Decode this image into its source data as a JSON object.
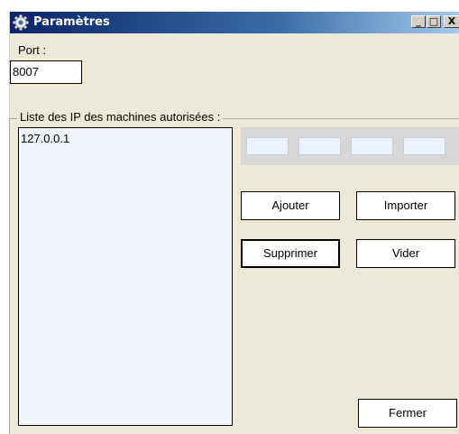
{
  "window": {
    "title": "Paramètres",
    "controls": {
      "minimize": "_",
      "maximize": "□",
      "close": "X"
    }
  },
  "port": {
    "label": "Port :",
    "value": "8007"
  },
  "allowed_ips": {
    "group_label": "Liste des IP des machines autorisées :",
    "items": [
      "127.0.0.1"
    ],
    "entry_octets": [
      "",
      "",
      "",
      ""
    ]
  },
  "buttons": {
    "add": "Ajouter",
    "import": "Importer",
    "delete": "Supprimer",
    "clear": "Vider",
    "close": "Fermer"
  },
  "colors": {
    "titlebar_start": "#0a246a",
    "titlebar_end": "#a6caf0",
    "dialog_background": "#ece9d8",
    "list_background": "#f0f5fe",
    "ip_entry_background": "#d7d7d7"
  },
  "icons": {
    "title": "gear-icon"
  }
}
